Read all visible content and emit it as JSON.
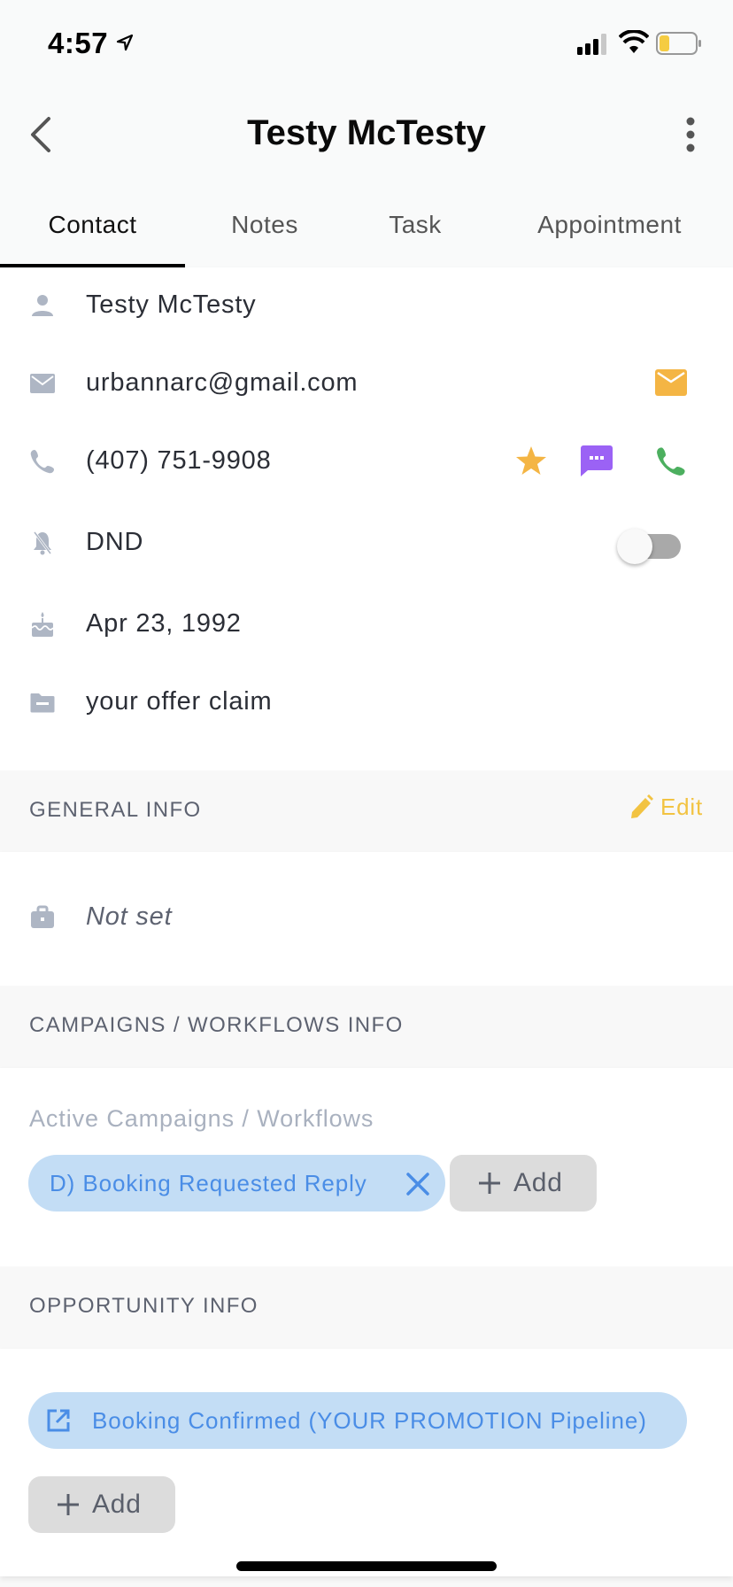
{
  "status_bar": {
    "time": "4:57",
    "battery_color": "#f5cc42"
  },
  "header": {
    "title": "Testy McTesty",
    "back_icon": "chevron-left-icon",
    "menu_icon": "more-vertical-icon"
  },
  "tabs": [
    {
      "label": "Contact",
      "active": true
    },
    {
      "label": "Notes",
      "active": false
    },
    {
      "label": "Task",
      "active": false
    },
    {
      "label": "Appointment",
      "active": false
    }
  ],
  "contact": {
    "name": "Testy McTesty",
    "email": "urbannarc@gmail.com",
    "phone": "(407) 751-9908",
    "dnd_label": "DND",
    "dnd_enabled": false,
    "birthday": "Apr 23, 1992",
    "source": "your offer claim"
  },
  "general_info": {
    "heading": "GENERAL INFO",
    "edit_label": "Edit",
    "company": "Not set"
  },
  "campaigns": {
    "heading": "CAMPAIGNS / WORKFLOWS INFO",
    "sublabel": "Active Campaigns / Workflows",
    "items": [
      {
        "label": "D) Booking Requested Reply"
      }
    ],
    "add_label": "Add"
  },
  "opportunity": {
    "heading": "OPPORTUNITY INFO",
    "items": [
      {
        "label": "Booking Confirmed (YOUR PROMOTION Pipeline)"
      }
    ],
    "add_label": "Add"
  },
  "colors": {
    "email_action": "#f4b544",
    "star": "#f4b544",
    "sms": "#9b62f5",
    "call": "#4caf5f",
    "edit": "#f2c342",
    "chip_bg": "#c3ddf5",
    "chip_text": "#4a8de6",
    "row_icon": "#aeb6c4"
  }
}
